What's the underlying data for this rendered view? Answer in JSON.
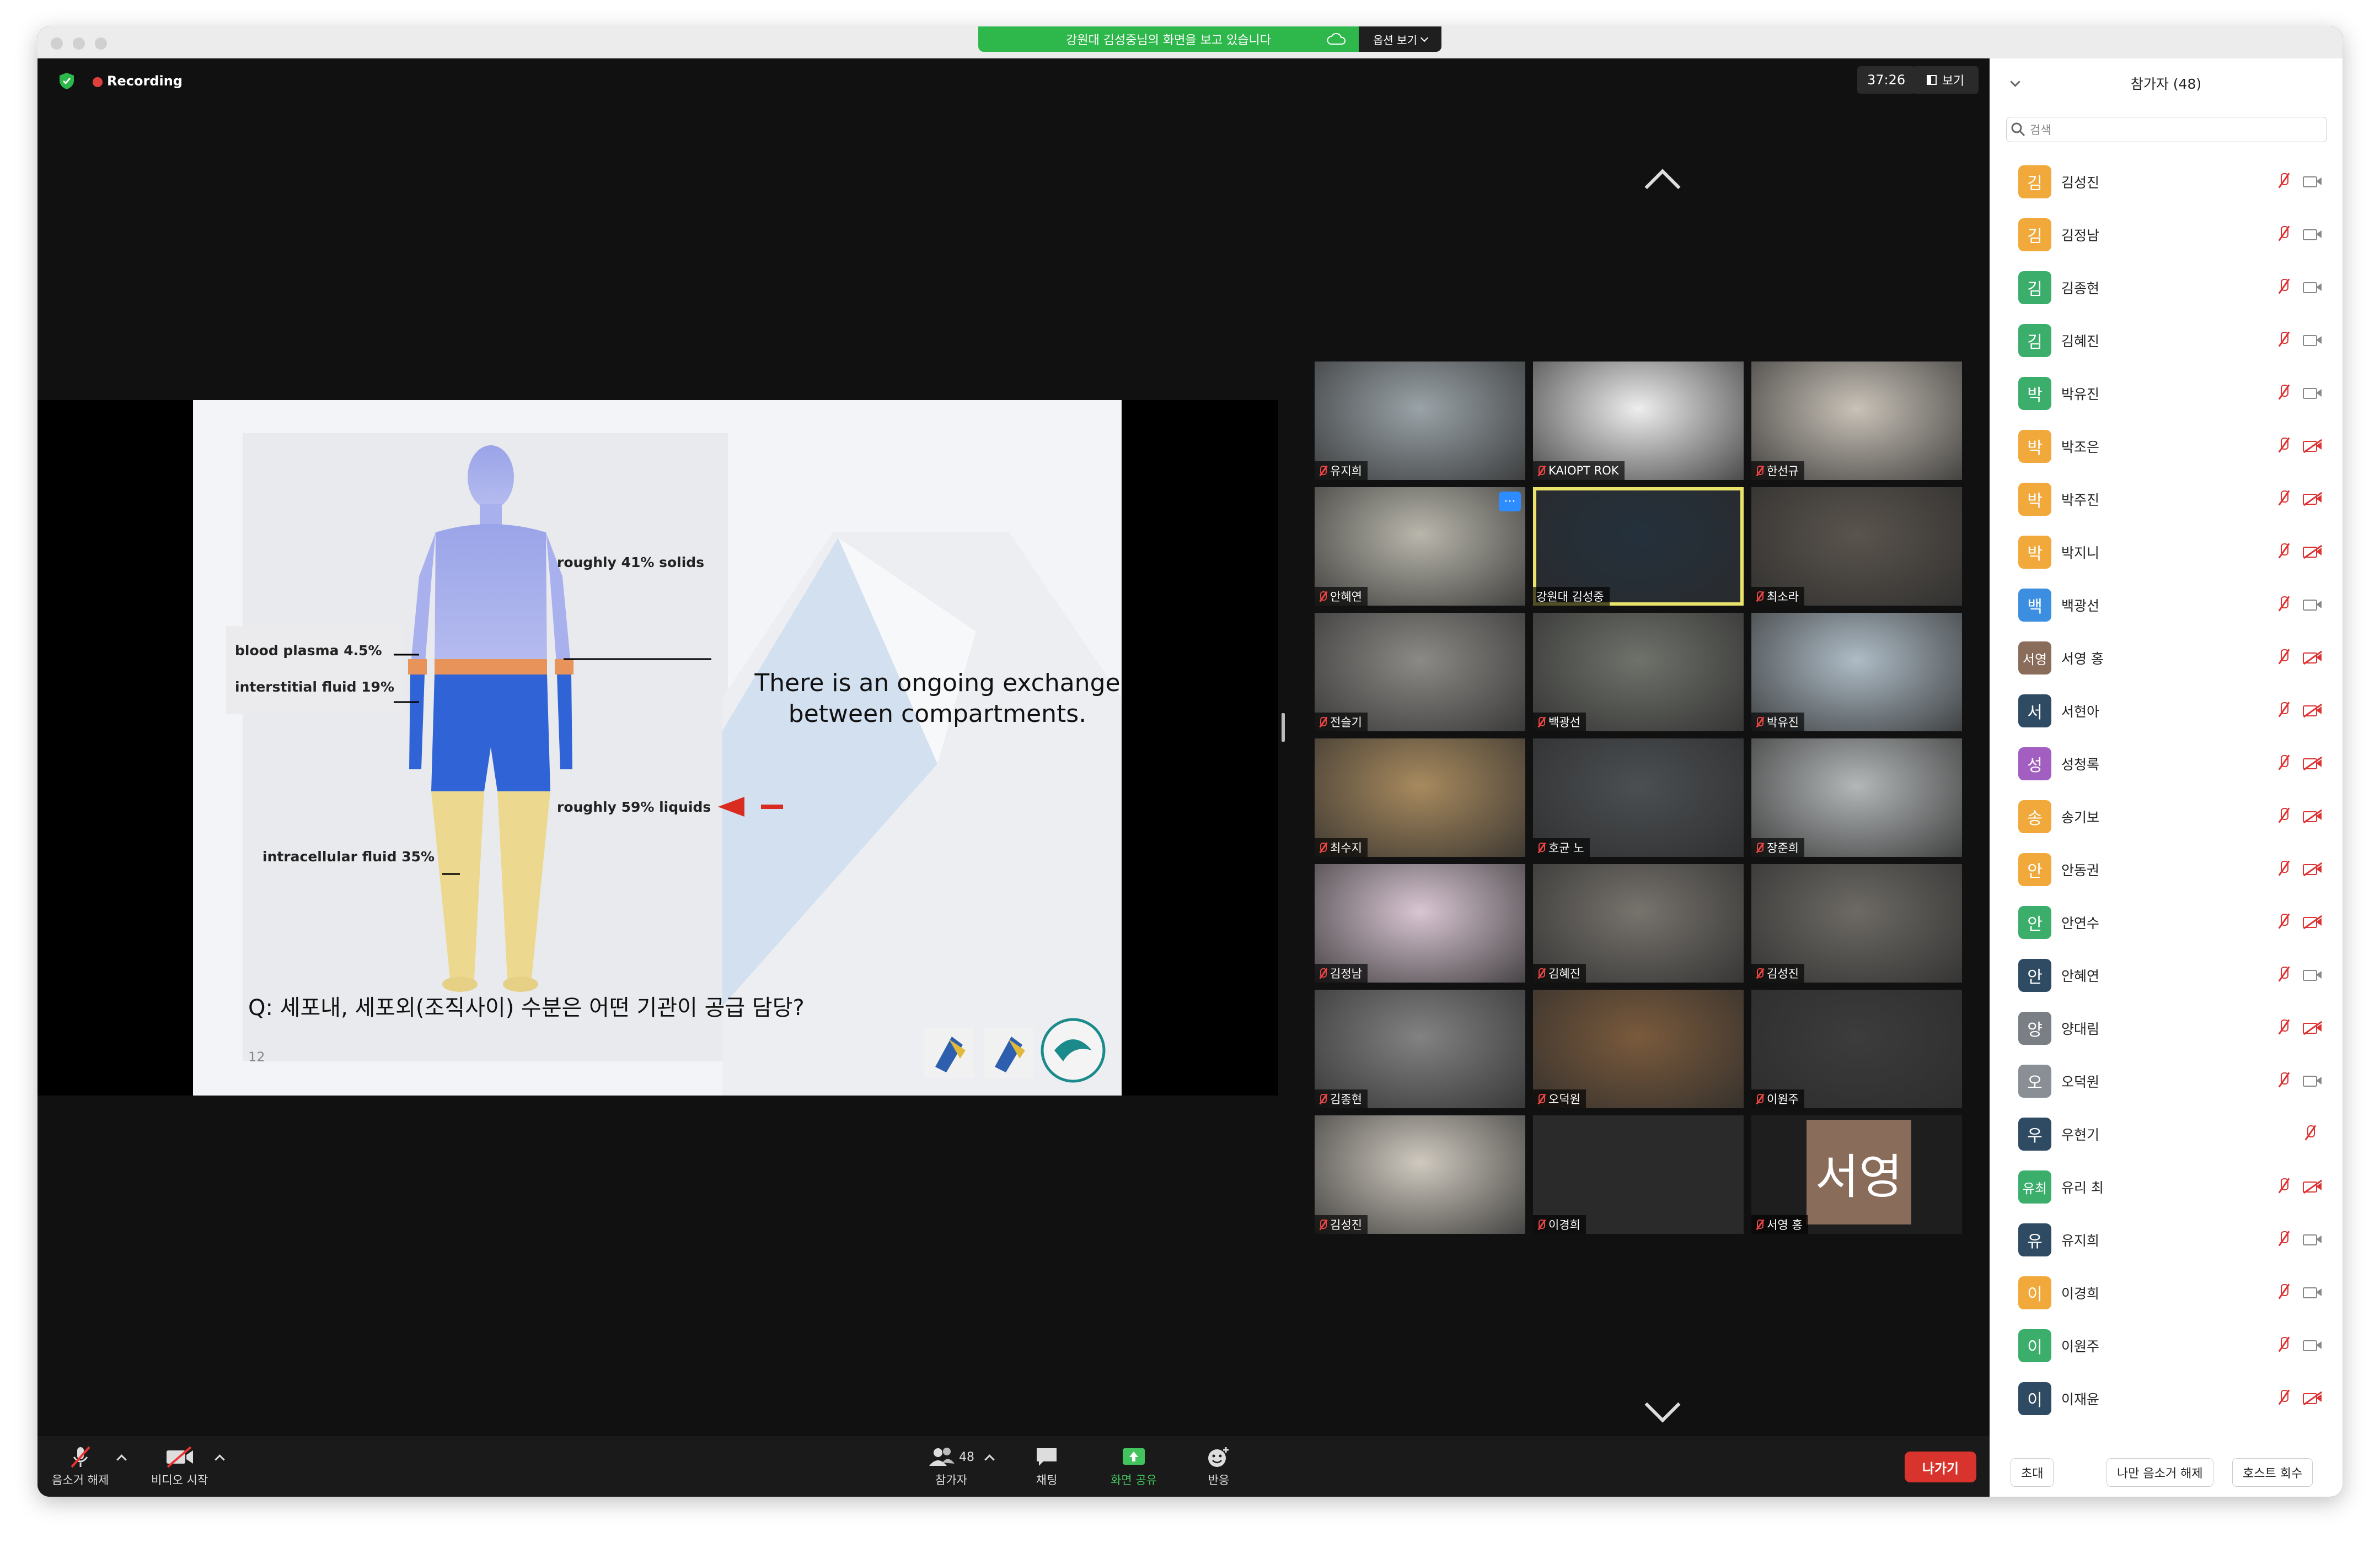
{
  "banner": {
    "text": "강원대 김성중님의 화면을 보고 있습니다",
    "options": "옵션 보기"
  },
  "recording": "Recording",
  "timer": "37:26",
  "view_label": "보기",
  "slide": {
    "label_solids": "roughly 41% solids",
    "label_plasma": "blood plasma 4.5%",
    "label_interstitial": "interstitial fluid 19%",
    "label_liquids": "roughly 59% liquids",
    "label_intracellular": "intracellular fluid 35%",
    "exchange_line1": "There is an ongoing exchange",
    "exchange_line2": "between compartments.",
    "question": "Q: 세포내, 세포외(조직사이) 수분은 어떤 기관이 공급 담당?",
    "page_number": "12"
  },
  "video_tiles": [
    {
      "name": "유지희",
      "muted": true,
      "bg": "#9aa3a8"
    },
    {
      "name": "KAIOPT ROK",
      "muted": true,
      "bg": "#eeeeee"
    },
    {
      "name": "한선규",
      "muted": true,
      "bg": "#c9c2b8"
    },
    {
      "name": "안혜연",
      "muted": true,
      "bg": "#b9b7ac"
    },
    {
      "name": "강원대 김성중",
      "muted": false,
      "bg": "#24303c"
    },
    {
      "name": "최소라",
      "muted": true,
      "bg": "#5a544d"
    },
    {
      "name": "전슬기",
      "muted": true,
      "bg": "#8c8a86"
    },
    {
      "name": "백광선",
      "muted": true,
      "bg": "#6f726b"
    },
    {
      "name": "박유진",
      "muted": true,
      "bg": "#aebcc6"
    },
    {
      "name": "최수지",
      "muted": true,
      "bg": "#a88a5e"
    },
    {
      "name": "호균 노",
      "muted": true,
      "bg": "#4b4f52"
    },
    {
      "name": "장준희",
      "muted": true,
      "bg": "#b3b7b8"
    },
    {
      "name": "김정남",
      "muted": true,
      "bg": "#d9c6d3"
    },
    {
      "name": "김혜진",
      "muted": true,
      "bg": "#77736d"
    },
    {
      "name": "김성진",
      "muted": true,
      "bg": "#6d6a65"
    },
    {
      "name": "김종현",
      "muted": true,
      "bg": "#828282"
    },
    {
      "name": "오덕원",
      "muted": true,
      "bg": "#7a5a3c"
    },
    {
      "name": "이원주",
      "muted": true,
      "bg": "#3c3c3c"
    },
    {
      "name": "김성진",
      "muted": true,
      "bg": "#cfc9bf"
    },
    {
      "name": "이경희",
      "muted": true,
      "bg": "#2a2a2a"
    },
    {
      "name": "서영 홍",
      "muted": true,
      "bg": "#1e1e1e",
      "avatar_text": "서영"
    }
  ],
  "toolbar": {
    "unmute": "음소거 해제",
    "start_video": "비디오 시작",
    "participants": "참가자",
    "participants_count": "48",
    "chat": "채팅",
    "share": "화면 공유",
    "reactions": "반응",
    "leave": "나가기"
  },
  "panel": {
    "title": "참가자 (48)",
    "search_placeholder": "검색",
    "participants": [
      {
        "initial": "김",
        "name": "김성진",
        "color": "#f0a93a",
        "camera_off": false
      },
      {
        "initial": "김",
        "name": "김정남",
        "color": "#f0a93a",
        "camera_off": false
      },
      {
        "initial": "김",
        "name": "김종현",
        "color": "#3cae6b",
        "camera_off": false
      },
      {
        "initial": "김",
        "name": "김혜진",
        "color": "#3cae6b",
        "camera_off": false
      },
      {
        "initial": "박",
        "name": "박유진",
        "color": "#3cae6b",
        "camera_off": false
      },
      {
        "initial": "박",
        "name": "박조은",
        "color": "#f0a93a",
        "camera_off": true
      },
      {
        "initial": "박",
        "name": "박주진",
        "color": "#f0a93a",
        "camera_off": true
      },
      {
        "initial": "박",
        "name": "박지니",
        "color": "#f0a93a",
        "camera_off": true
      },
      {
        "initial": "백",
        "name": "백광선",
        "color": "#3b8ee0",
        "camera_off": false
      },
      {
        "initial": "서영",
        "name": "서영 홍",
        "color": "#8a6c5a",
        "camera_off": true
      },
      {
        "initial": "서",
        "name": "서현아",
        "color": "#2f4b63",
        "camera_off": true
      },
      {
        "initial": "성",
        "name": "성청록",
        "color": "#a25fc1",
        "camera_off": true
      },
      {
        "initial": "송",
        "name": "송기보",
        "color": "#f0a93a",
        "camera_off": true
      },
      {
        "initial": "안",
        "name": "안동권",
        "color": "#f0a93a",
        "camera_off": true
      },
      {
        "initial": "안",
        "name": "안연수",
        "color": "#3cae6b",
        "camera_off": true
      },
      {
        "initial": "안",
        "name": "안혜연",
        "color": "#2f4b63",
        "camera_off": false
      },
      {
        "initial": "양",
        "name": "양대림",
        "color": "#7a7f86",
        "camera_off": true
      },
      {
        "initial": "오",
        "name": "오덕원",
        "color": "#8a8f96",
        "camera_off": false
      },
      {
        "initial": "우",
        "name": "우현기",
        "color": "#2f4b63",
        "camera_off": false,
        "no_camera": true
      },
      {
        "initial": "유최",
        "name": "유리 최",
        "color": "#3cae6b",
        "camera_off": true
      },
      {
        "initial": "유",
        "name": "유지희",
        "color": "#2f4b63",
        "camera_off": false
      },
      {
        "initial": "이",
        "name": "이경희",
        "color": "#f0a93a",
        "camera_off": false
      },
      {
        "initial": "이",
        "name": "이원주",
        "color": "#3cae6b",
        "camera_off": false
      },
      {
        "initial": "이",
        "name": "이재윤",
        "color": "#2f4b63",
        "camera_off": true
      }
    ],
    "invite": "초대",
    "unmute_me": "나만 음소거 해제",
    "reclaim_host": "호스트 회수"
  }
}
